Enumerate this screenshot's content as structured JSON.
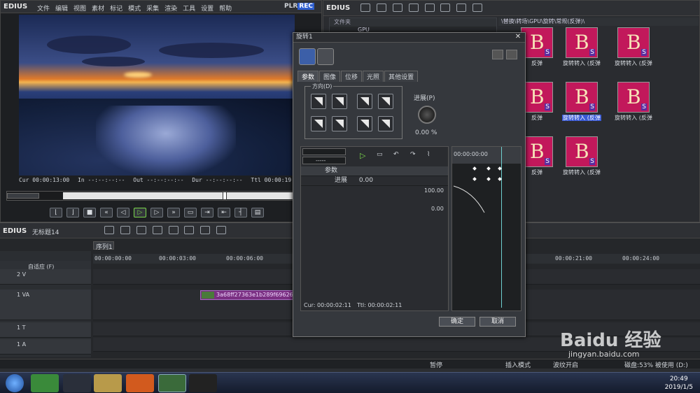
{
  "preview": {
    "logo": "EDIUS",
    "menu": [
      "文件",
      "编辑",
      "视图",
      "素材",
      "标记",
      "模式",
      "采集",
      "渲染",
      "工具",
      "设置",
      "帮助"
    ],
    "plr": "PLR",
    "rec": "REC",
    "cur": "Cur 00:00:13:00",
    "in": "In --:--:--:--",
    "out": "Out --:--:--:--",
    "dur": "Dur --:--:--:--",
    "ttl": "Ttl 00:00:19:"
  },
  "bin": {
    "logo": "EDIUS",
    "tree_header": "文件夹",
    "tree_row": "GPU",
    "path": "\\替换\\转场\\GPU\\旋转\\常规(反弹)\\",
    "items": [
      {
        "label": "反弹"
      },
      {
        "label": "旋转转入 (反弹"
      },
      {
        "label": "旋转转入 (反弹"
      },
      {
        "label": "反弹"
      },
      {
        "label": "旋转转入 (反弹"
      },
      {
        "label": "旋转转入 (反弹"
      },
      {
        "label": "反弹"
      },
      {
        "label": "旋转转入 (反弹"
      }
    ]
  },
  "timeline": {
    "logo": "EDIUS",
    "title": "无标题14",
    "sequence_tab": "序列1",
    "ruler": [
      "00:00:00:00",
      "00:00:03:00",
      "00:00:06:00",
      "00:00:21:00",
      "00:00:24:00"
    ],
    "mode_label": "自适应 (F)",
    "tracks": [
      "2 V",
      "1 VA",
      "1 T",
      "1 A"
    ],
    "clip_name": "3a68ff27363e1b289f69626",
    "status": {
      "pause": "暂停",
      "insert_mode": "插入模式",
      "ripple": "波纹开启",
      "disk": "磁盘:53% 被使用 (D:)"
    }
  },
  "dialog": {
    "title": "旋转1",
    "tabs": [
      "参数",
      "图像",
      "位移",
      "光照",
      "其他设置"
    ],
    "direction_caption": "方向(D)",
    "progress_label": "进展(P)",
    "progress_value": "0.00 %",
    "kf_dropdown": "-----",
    "kf_rows": [
      {
        "label": "参数"
      },
      {
        "label": "进展",
        "value": "0.00"
      }
    ],
    "graph_max": "100.00",
    "graph_min": "0.00",
    "graph_time": "00:00:00:00",
    "cur": "Cur: 00:00:02:11",
    "ttl": "Ttl: 00:00:02:11",
    "ok": "确定",
    "cancel": "取消"
  },
  "taskbar": {
    "time": "20:49",
    "date": "2019/1/5"
  },
  "watermark": {
    "brand": "Baidu 经验",
    "url": "jingyan.baidu.com"
  },
  "colors": {
    "accent": "#3b5bd6",
    "clip": "#7a2f82",
    "play": "#7ad84a",
    "rec": "#2f5fd0"
  }
}
